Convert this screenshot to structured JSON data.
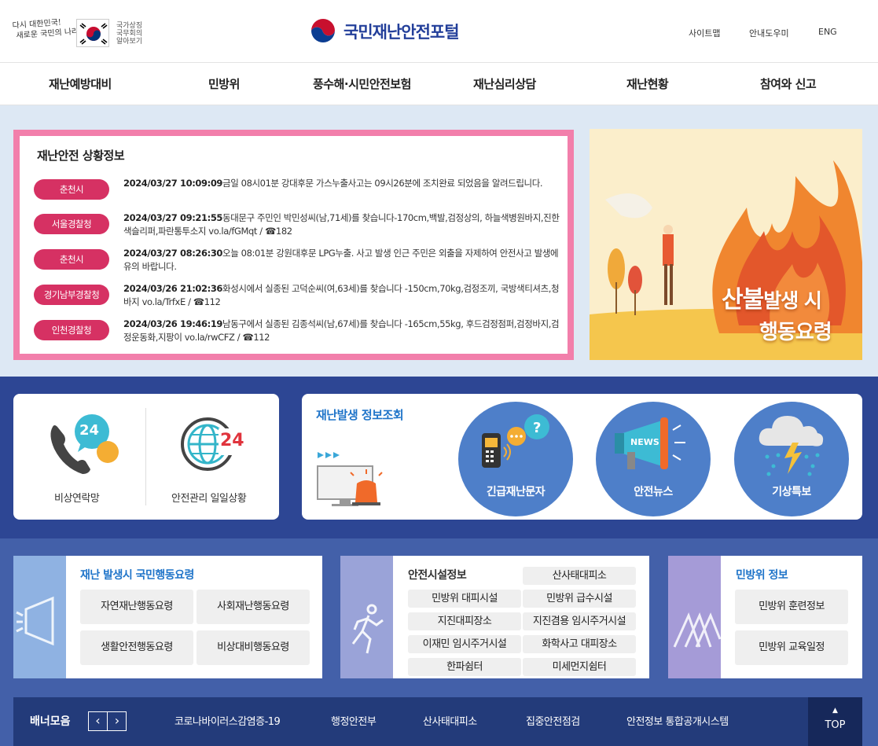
{
  "header": {
    "slogan_line1": "다시 대한민국!",
    "slogan_line2": "새로운 국민의 나라",
    "symbol_text": [
      "국가상징",
      "국무회의",
      "알아보기"
    ],
    "logo_text": "국민재난안전포털",
    "links": [
      "사이트맵",
      "안내도우미",
      "ENG"
    ]
  },
  "gnb": [
    "재난예방대비",
    "민방위",
    "풍수해·시민안전보험",
    "재난심리상담",
    "재난현황",
    "참여와 신고"
  ],
  "situation": {
    "title": "재난안전 상황정보",
    "items": [
      {
        "badge": "춘천시",
        "time": "2024/03/27 10:09:09",
        "text": "금일 08시01분 강대후문 가스누출사고는 09시26분에 조치완료 되었음을 알려드립니다."
      },
      {
        "badge": "서울경찰청",
        "time": "2024/03/27 09:21:55",
        "text": "동대문구 주민인 박민성씨(남,71세)를 찾습니다-170cm,백발,검정상의, 하늘색병원바지,진한색슬리퍼,파란통투소지 vo.la/fGMqt / ☎182"
      },
      {
        "badge": "춘천시",
        "time": "2024/03/27 08:26:30",
        "text": "오늘 08:01분 강원대후문 LPG누출. 사고 발생 인근 주민은 외출을 자제하여 안전사고 발생에 유의 바랍니다."
      },
      {
        "badge": "경기남부경찰청",
        "time": "2024/03/26 21:02:36",
        "text": "화성시에서 실종된 고덕순씨(여,63세)를 찾습니다 -150cm,70kg,검정조끼, 국방색티셔츠,청바지 vo.la/TrfxE / ☎112"
      },
      {
        "badge": "인천경찰청",
        "time": "2024/03/26 19:46:19",
        "text": "남동구에서 실종된 김종석씨(남,67세)를 찾습니다 -165cm,55kg, 후드검정점퍼,검정바지,검정운동화,지팡이 vo.la/rwCFZ / ☎112"
      }
    ]
  },
  "fire_banner": {
    "text_main": "산불",
    "text_sub": "발생 시",
    "text_line2": "행동요령"
  },
  "quick": {
    "emergency_label": "비상연락망",
    "emergency_icon_text": "24",
    "daily_label": "안전관리 일일상황",
    "daily_icon_text": "24"
  },
  "info_lookup": {
    "title": "재난발생 정보조회",
    "buttons": [
      {
        "label": "긴급재난문자",
        "icon": "phone-chat-icon"
      },
      {
        "label": "안전뉴스",
        "icon": "megaphone-icon",
        "icon_text": "NEWS"
      },
      {
        "label": "기상특보",
        "icon": "storm-cloud-icon"
      }
    ]
  },
  "action_guide": {
    "title": "재난 발생시 국민행동요령",
    "buttons": [
      "자연재난행동요령",
      "사회재난행동요령",
      "생활안전행동요령",
      "비상대비행동요령"
    ]
  },
  "facility": {
    "title": "안전시설정보",
    "buttons": [
      "산사태대피소",
      "민방위 대피시설",
      "민방위 급수시설",
      "지진대피장소",
      "지진겸용 임시주거시설",
      "이재민 임시주거시설",
      "화학사고 대피장소",
      "한파쉼터",
      "미세먼지쉼터"
    ]
  },
  "civil_defense": {
    "title": "민방위 정보",
    "buttons": [
      "민방위 훈련정보",
      "민방위 교육일정"
    ]
  },
  "banner": {
    "title": "배너모음",
    "prev": "‹",
    "next": "›",
    "links": [
      "코로나바이러스감염증-19",
      "행정안전부",
      "산사태대피소",
      "집중안전점검",
      "안전정보 통합공개시스템"
    ],
    "top_label": "TOP",
    "top_arrow": "▲"
  },
  "colors": {
    "accent_blue": "#233f9a",
    "badge_red": "#d63163",
    "pink_border": "#f27fab",
    "circle_blue": "#4e7fc9",
    "nav_dark": "#233b7a"
  }
}
